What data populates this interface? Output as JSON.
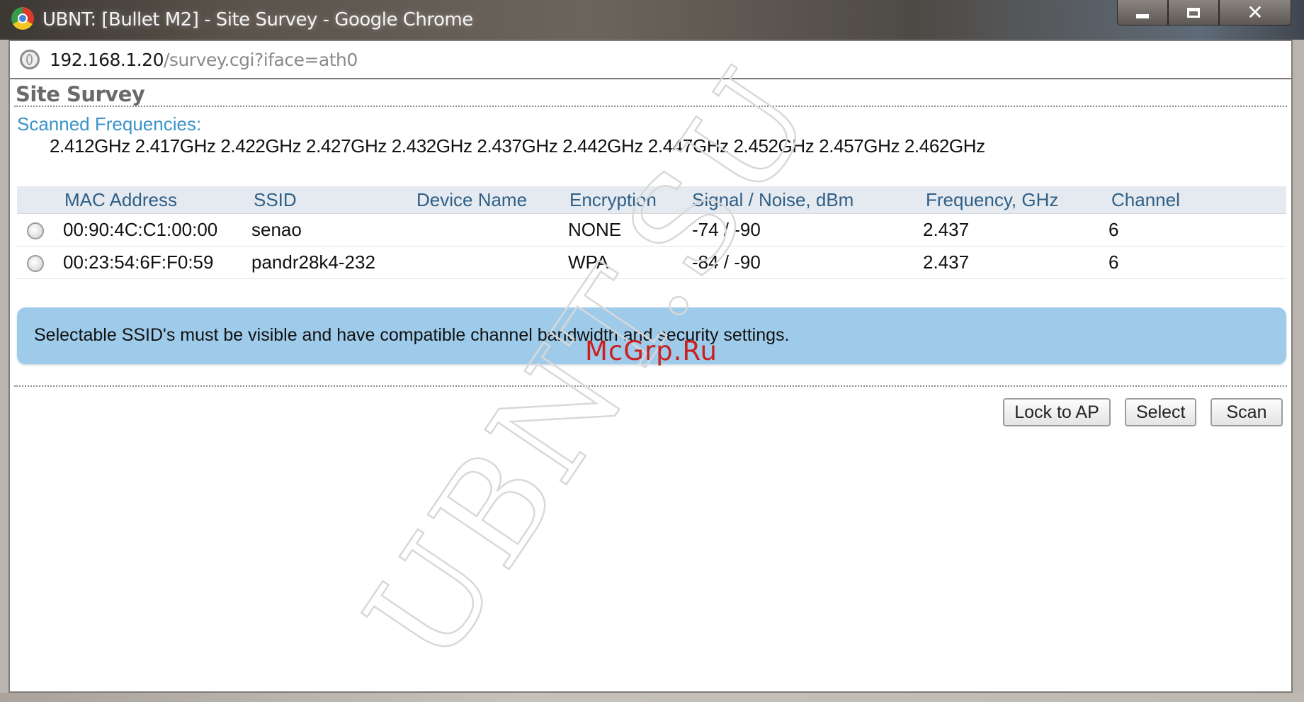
{
  "window": {
    "title": "UBNT: [Bullet M2] - Site Survey - Google Chrome"
  },
  "address_bar": {
    "host": "192.168.1.20",
    "path": "/survey.cgi?iface=ath0"
  },
  "page": {
    "title": "Site Survey",
    "scanned_frequencies_label": "Scanned Frequencies:",
    "scanned_frequencies": "2.412GHz 2.417GHz 2.422GHz 2.427GHz 2.432GHz 2.437GHz 2.442GHz 2.447GHz 2.452GHz 2.457GHz 2.462GHz"
  },
  "table": {
    "columns": [
      "MAC Address",
      "SSID",
      "Device Name",
      "Encryption",
      "Signal / Noise, dBm",
      "Frequency, GHz",
      "Channel"
    ],
    "rows": [
      {
        "mac": "00:90:4C:C1:00:00",
        "ssid": "senao",
        "device_name": "",
        "encryption": "NONE",
        "signal_noise": "-74 / -90",
        "frequency": "2.437",
        "channel": "6"
      },
      {
        "mac": "00:23:54:6F:F0:59",
        "ssid": "pandr28k4-232",
        "device_name": "",
        "encryption": "WPA",
        "signal_noise": "-84 / -90",
        "frequency": "2.437",
        "channel": "6"
      }
    ]
  },
  "notice": {
    "text": "Selectable SSID's must be visible and have compatible channel bandwidth and security settings."
  },
  "buttons": {
    "lock_to_ap": "Lock to AP",
    "select": "Select",
    "scan": "Scan"
  },
  "overlay": {
    "watermark": "UBNT.SU",
    "brand_stamp": "McGrp.Ru",
    "brand_stamp_color": "#cc1f1f"
  },
  "colors": {
    "label_blue": "#3a93c8",
    "header_text": "#2f5f86",
    "notice_bg": "#9fcbea"
  }
}
